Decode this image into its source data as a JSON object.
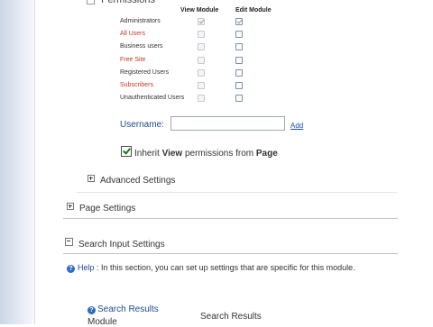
{
  "permissions": {
    "columns": [
      "View Module",
      "Edit Module"
    ],
    "roles": [
      {
        "name": "Administrators",
        "color": "#333333",
        "view_checked": true,
        "edit_checked": true
      },
      {
        "name": "All Users",
        "color": "#c0392b",
        "view_checked": false,
        "edit_checked": false
      },
      {
        "name": "Business users",
        "color": "#333333",
        "view_checked": false,
        "edit_checked": false
      },
      {
        "name": "Free Site",
        "color": "#c0392b",
        "view_checked": false,
        "edit_checked": false
      },
      {
        "name": "Registered Users",
        "color": "#333333",
        "view_checked": false,
        "edit_checked": false
      },
      {
        "name": "Subscribers",
        "color": "#c0392b",
        "view_checked": false,
        "edit_checked": false
      },
      {
        "name": "Unauthenticated Users",
        "color": "#333333",
        "view_checked": false,
        "edit_checked": false
      }
    ],
    "username_label": "Username:",
    "username_value": "",
    "add_label": "Add",
    "inherit": {
      "checked": true,
      "prefix": "Inherit ",
      "bold1": "View",
      "middle": " permissions from ",
      "bold2": "Page"
    }
  },
  "sections": {
    "advanced_settings": "Advanced Settings",
    "page_settings": "Page Settings",
    "search_input_settings": "Search Input Settings"
  },
  "help": {
    "label": "Help",
    "text": ":  In this section, you can set up settings that are specific for this module."
  },
  "bottom": {
    "search_results_link": "Search Results",
    "search_results_value": "Search Results",
    "cut_label": "Module"
  },
  "icons": {
    "help": "question-icon",
    "expand": "plus-box-icon",
    "collapse": "minus-box-icon",
    "cursor": "mouse-cursor-icon"
  },
  "colors": {
    "link": "#1d4fa7",
    "label_blue": "#1f4a8c",
    "red_role": "#c0392b",
    "help_icon": "#2d6bc4",
    "left_bar": "#cdd6e6"
  }
}
